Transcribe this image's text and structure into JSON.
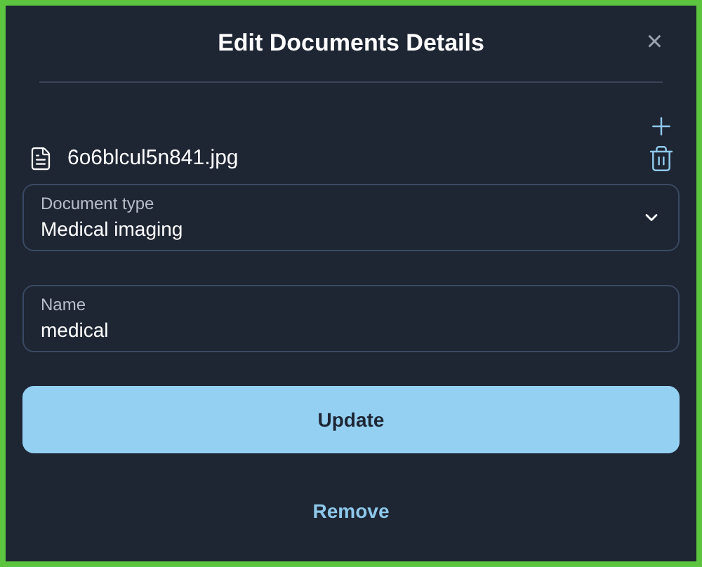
{
  "dialog": {
    "title": "Edit Documents Details",
    "close": "×"
  },
  "file": {
    "name": "6o6blcul5n841.jpg"
  },
  "document_type": {
    "label": "Document type",
    "value": "Medical imaging"
  },
  "name_field": {
    "label": "Name",
    "value": "medical"
  },
  "buttons": {
    "update": "Update",
    "remove": "Remove"
  }
}
